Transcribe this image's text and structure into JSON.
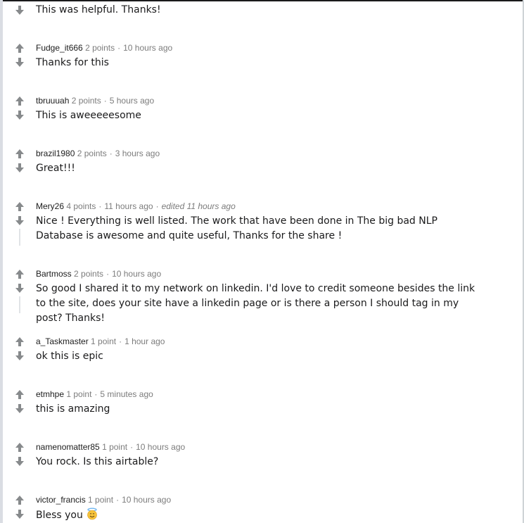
{
  "comments": [
    {
      "author": "",
      "points": "",
      "time": "",
      "edited": "",
      "text": "This was helpful. Thanks!"
    },
    {
      "author": "Fudge_it666",
      "points": "2 points",
      "time": "10 hours ago",
      "edited": "",
      "text": "Thanks for this"
    },
    {
      "author": "tbruuuah",
      "points": "2 points",
      "time": "5 hours ago",
      "edited": "",
      "text": "This is aweeeeesome"
    },
    {
      "author": "brazil1980",
      "points": "2 points",
      "time": "3 hours ago",
      "edited": "",
      "text": "Great!!!"
    },
    {
      "author": "Mery26",
      "points": "4 points",
      "time": "11 hours ago",
      "edited": "edited 11 hours ago",
      "text": "Nice ! Everything is well listed. The work that have been done in The big bad NLP Database is awesome and quite useful, Thanks for the share !"
    },
    {
      "author": "Bartmoss",
      "points": "2 points",
      "time": "10 hours ago",
      "edited": "",
      "text": "So good I shared it to my network on linkedin. I'd love to credit someone besides the link to the site, does your site have a linkedin page or is there a person I should tag in my post? Thanks!"
    },
    {
      "author": "a_Taskmaster",
      "points": "1 point",
      "time": "1 hour ago",
      "edited": "",
      "text": "ok this is epic"
    },
    {
      "author": "etmhpe",
      "points": "1 point",
      "time": "5 minutes ago",
      "edited": "",
      "text": "this is amazing"
    },
    {
      "author": "namenomatter85",
      "points": "1 point",
      "time": "10 hours ago",
      "edited": "",
      "text": "You rock. Is this airtable?"
    },
    {
      "author": "victor_francis",
      "points": "1 point",
      "time": "10 hours ago",
      "edited": "",
      "text": "Bless you",
      "emoji": "smiling-face-with-halo"
    }
  ],
  "colors": {
    "vote_arrow": "#878a8c",
    "meta": "#7c7c7c",
    "author": "#1c1c1c",
    "thread_line": "#dadde3"
  }
}
